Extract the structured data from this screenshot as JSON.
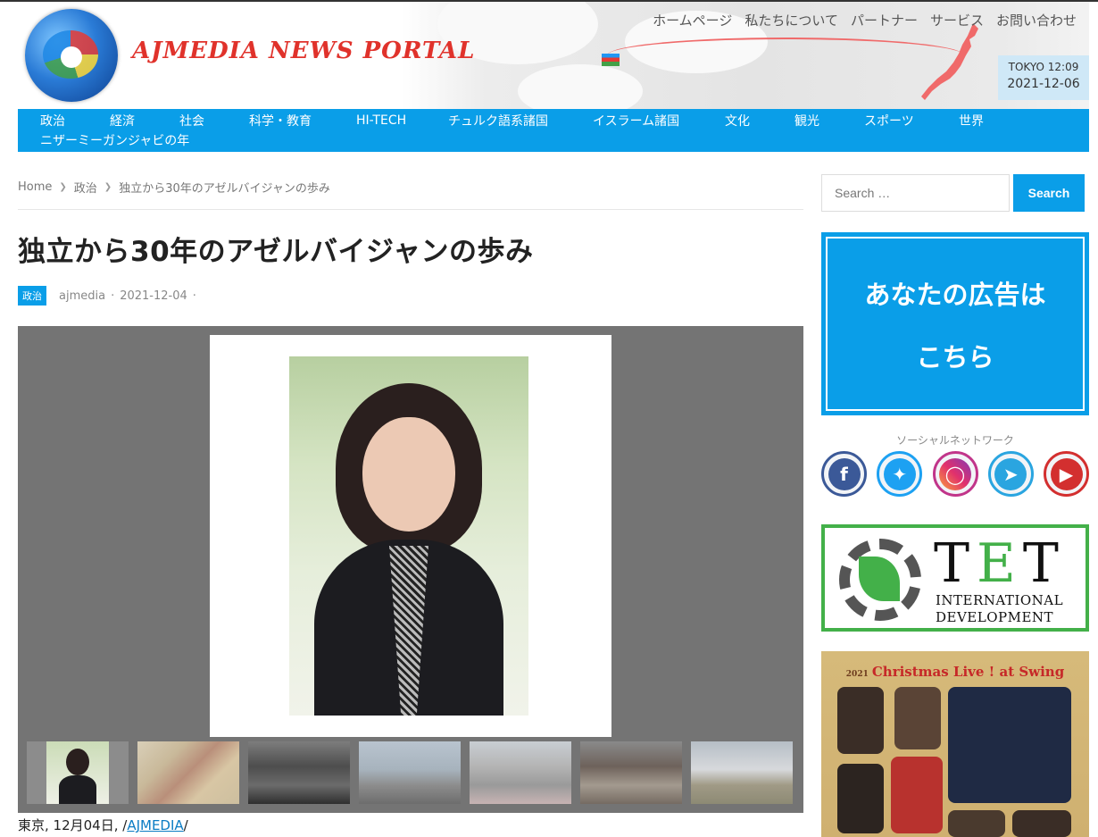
{
  "site": {
    "logo_text": "AJMEDIA NEWS PORTAL",
    "top_nav": [
      "ホームページ",
      "私たちについて",
      "パートナー",
      "サービス",
      "お問い合わせ"
    ],
    "clock": {
      "city_time": "TOKYO 12:09",
      "date": "2021-12-06"
    }
  },
  "main_nav": {
    "row1": [
      {
        "label": "政治",
        "w": 78
      },
      {
        "label": "経済",
        "w": 78
      },
      {
        "label": "社会",
        "w": 78
      },
      {
        "label": "科学・教育",
        "w": 120
      },
      {
        "label": "HI-TECH",
        "w": 103
      },
      {
        "label": "チュルク語系諸国",
        "w": 162
      },
      {
        "label": "イスラーム諸国",
        "w": 148
      },
      {
        "label": "文化",
        "w": 78
      },
      {
        "label": "観光",
        "w": 78
      },
      {
        "label": "スポーツ",
        "w": 106
      },
      {
        "label": "世界",
        "w": 60
      }
    ],
    "row2": [
      "ニザーミーガンジャビの年"
    ]
  },
  "breadcrumb": {
    "home": "Home",
    "category": "政治",
    "current": "独立から30年のアゼルバイジャンの歩み"
  },
  "article": {
    "title": "独立から30年のアゼルバイジャンの歩み",
    "category": "政治",
    "author": "ajmedia",
    "date": "2021-12-04",
    "caption_prefix": "東京, 12月04日, /",
    "caption_link": "AJMEDIA",
    "caption_suffix": "/"
  },
  "sidebar": {
    "search_placeholder": "Search …",
    "search_button": "Search",
    "ad_line1": "あなたの広告は",
    "ad_line2": "こちら",
    "social_label": "ソーシャルネットワーク",
    "social_icons": [
      "facebook-icon",
      "twitter-icon",
      "instagram-icon",
      "telegram-icon",
      "youtube-icon"
    ],
    "tet_big": "TET",
    "tet_line1": "INTERNATIONAL",
    "tet_line2": "DEVELOPMENT",
    "xmas_year": "2021",
    "xmas_title": "Christmas Live ! at Swing"
  },
  "colors": {
    "accent": "#0a9ee8",
    "logo_red": "#e0322b",
    "tet_green": "#43b049"
  }
}
